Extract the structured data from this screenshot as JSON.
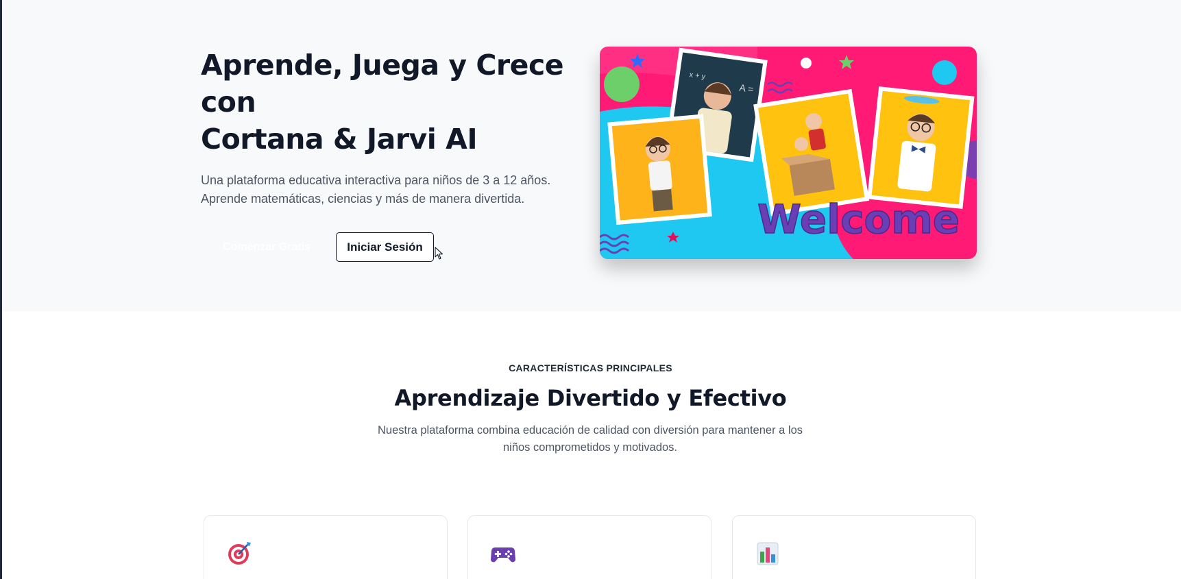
{
  "hero": {
    "title_line1": "Aprende, Juega y Crece",
    "title_line2": "con",
    "title_line3": "Cortana & Jarvi AI",
    "subtitle_line1": "Una plataforma educativa interactiva para niños de 3 a 12 años.",
    "subtitle_line2": "Aprende matemáticas, ciencias y más de manera divertida.",
    "primary_button": "Comenzar Gratis",
    "secondary_button": "Iniciar Sesión",
    "image_text": "Welcome"
  },
  "features": {
    "eyebrow": "CARACTERÍSTICAS PRINCIPALES",
    "title": "Aprendizaje Divertido y Efectivo",
    "description": "Nuestra plataforma combina educación de calidad con diversión para mantener a los niños comprometidos y motivados.",
    "cards": [
      {
        "icon": "target-icon"
      },
      {
        "icon": "gamepad-icon"
      },
      {
        "icon": "bar-chart-icon"
      }
    ]
  },
  "colors": {
    "hero_bg": "#f8f9fb",
    "title": "#111827",
    "body_text": "#4b5563",
    "image_pink": "#ff1a75",
    "image_cyan": "#1ec8f0",
    "welcome_purple": "#6a3fb5"
  }
}
